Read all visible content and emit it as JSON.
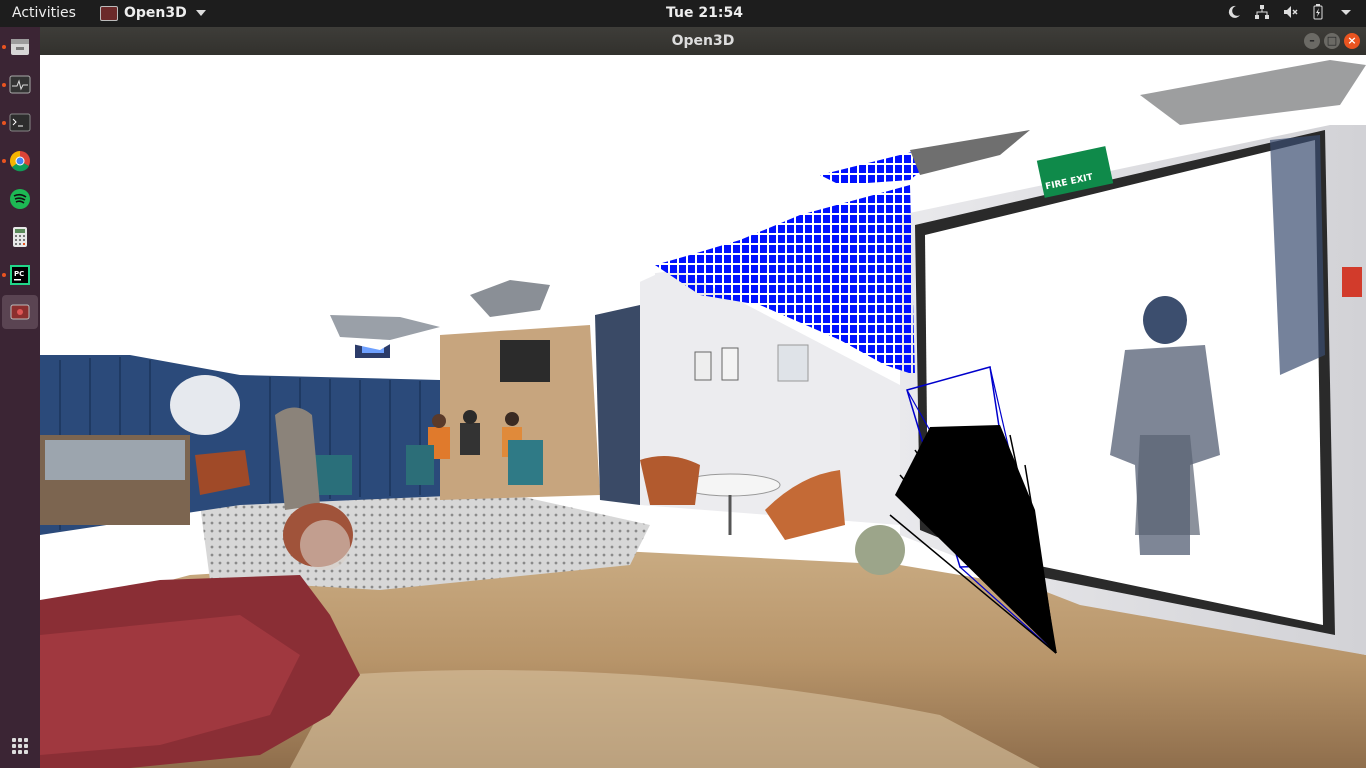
{
  "topbar": {
    "activities": "Activities",
    "app_name": "Open3D",
    "clock": "Tue 21:54"
  },
  "window": {
    "title": "Open3D"
  },
  "dock": {
    "items": [
      "files-icon",
      "system-monitor-icon",
      "terminal-icon",
      "chrome-icon",
      "spotify-icon",
      "calculator-icon",
      "pycharm-icon",
      "open3d-icon"
    ]
  },
  "scene": {
    "sign_text": "FIRE EXIT"
  }
}
